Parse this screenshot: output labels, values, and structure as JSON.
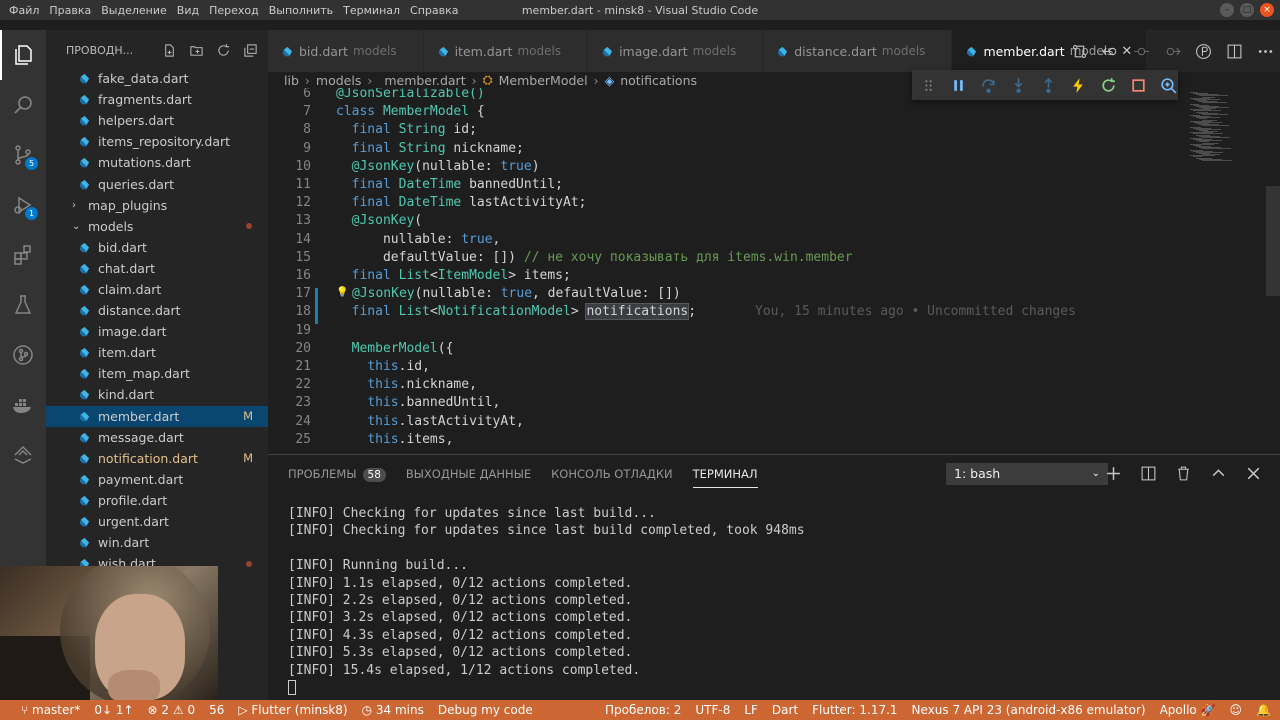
{
  "window": {
    "title": "member.dart - minsk8 - Visual Studio Code",
    "menu": [
      "Файл",
      "Правка",
      "Выделение",
      "Вид",
      "Переход",
      "Выполнить",
      "Терминал",
      "Справка"
    ]
  },
  "activity": {
    "scm_badge": "5",
    "debug_badge": "1",
    "icons": [
      "explorer-icon",
      "search-icon",
      "source-control-icon",
      "run-debug-icon",
      "extensions-icon",
      "testing-icon",
      "git-graph-icon",
      "docker-icon",
      "deploy-icon"
    ]
  },
  "sidebar": {
    "title": "ПРОВОДН...",
    "items": [
      {
        "label": "fake_data.dart",
        "indent": 2,
        "type": "file",
        "mark": ""
      },
      {
        "label": "fragments.dart",
        "indent": 2,
        "type": "file",
        "mark": ""
      },
      {
        "label": "helpers.dart",
        "indent": 2,
        "type": "file",
        "mark": ""
      },
      {
        "label": "items_repository.dart",
        "indent": 2,
        "type": "file",
        "mark": ""
      },
      {
        "label": "mutations.dart",
        "indent": 2,
        "type": "file",
        "mark": ""
      },
      {
        "label": "queries.dart",
        "indent": 2,
        "type": "file",
        "mark": ""
      },
      {
        "label": "map_plugins",
        "indent": 1,
        "type": "folder-closed",
        "mark": ""
      },
      {
        "label": "models",
        "indent": 1,
        "type": "folder-open",
        "mark": "dot"
      },
      {
        "label": "bid.dart",
        "indent": 2,
        "type": "file",
        "mark": ""
      },
      {
        "label": "chat.dart",
        "indent": 2,
        "type": "file",
        "mark": ""
      },
      {
        "label": "claim.dart",
        "indent": 2,
        "type": "file",
        "mark": ""
      },
      {
        "label": "distance.dart",
        "indent": 2,
        "type": "file",
        "mark": ""
      },
      {
        "label": "image.dart",
        "indent": 2,
        "type": "file",
        "mark": ""
      },
      {
        "label": "item.dart",
        "indent": 2,
        "type": "file",
        "mark": ""
      },
      {
        "label": "item_map.dart",
        "indent": 2,
        "type": "file",
        "mark": ""
      },
      {
        "label": "kind.dart",
        "indent": 2,
        "type": "file",
        "mark": ""
      },
      {
        "label": "member.dart",
        "indent": 2,
        "type": "file",
        "mark": "M",
        "selected": true
      },
      {
        "label": "message.dart",
        "indent": 2,
        "type": "file",
        "mark": ""
      },
      {
        "label": "notification.dart",
        "indent": 2,
        "type": "file",
        "mark": "M",
        "modified": true
      },
      {
        "label": "payment.dart",
        "indent": 2,
        "type": "file",
        "mark": ""
      },
      {
        "label": "profile.dart",
        "indent": 2,
        "type": "file",
        "mark": ""
      },
      {
        "label": "urgent.dart",
        "indent": 2,
        "type": "file",
        "mark": ""
      },
      {
        "label": "win.dart",
        "indent": 2,
        "type": "file",
        "mark": ""
      },
      {
        "label": "wish.dart",
        "indent": 2,
        "type": "file",
        "mark": "dot"
      }
    ]
  },
  "tabs": [
    {
      "name": "bid.dart",
      "desc": "models",
      "active": false
    },
    {
      "name": "item.dart",
      "desc": "models",
      "active": false
    },
    {
      "name": "image.dart",
      "desc": "models",
      "active": false
    },
    {
      "name": "distance.dart",
      "desc": "models",
      "active": false
    },
    {
      "name": "member.dart",
      "desc": "models",
      "active": true
    }
  ],
  "breadcrumbs": [
    "lib",
    "models",
    "member.dart",
    "MemberModel",
    "notifications"
  ],
  "editor": {
    "lines": [
      {
        "n": "6",
        "tokens": [
          [
            "an",
            "@JsonSerializable()"
          ]
        ]
      },
      {
        "n": "7",
        "tokens": [
          [
            "kw",
            "class "
          ],
          [
            "ty",
            "MemberModel"
          ],
          [
            "",
            " {"
          ]
        ]
      },
      {
        "n": "8",
        "tokens": [
          [
            "",
            "  "
          ],
          [
            "kw",
            "final "
          ],
          [
            "ty",
            "String"
          ],
          [
            "",
            " id;"
          ]
        ]
      },
      {
        "n": "9",
        "tokens": [
          [
            "",
            "  "
          ],
          [
            "kw",
            "final "
          ],
          [
            "ty",
            "String"
          ],
          [
            "",
            " nickname;"
          ]
        ]
      },
      {
        "n": "10",
        "tokens": [
          [
            "",
            "  "
          ],
          [
            "an",
            "@JsonKey"
          ],
          [
            "",
            "(nullable: "
          ],
          [
            "kw",
            "true"
          ],
          [
            "",
            ")"
          ]
        ]
      },
      {
        "n": "11",
        "tokens": [
          [
            "",
            "  "
          ],
          [
            "kw",
            "final "
          ],
          [
            "ty",
            "DateTime"
          ],
          [
            "",
            " bannedUntil;"
          ]
        ]
      },
      {
        "n": "12",
        "tokens": [
          [
            "",
            "  "
          ],
          [
            "kw",
            "final "
          ],
          [
            "ty",
            "DateTime"
          ],
          [
            "",
            " lastActivityAt;"
          ]
        ]
      },
      {
        "n": "13",
        "tokens": [
          [
            "",
            "  "
          ],
          [
            "an",
            "@JsonKey"
          ],
          [
            "",
            "("
          ]
        ]
      },
      {
        "n": "14",
        "tokens": [
          [
            "",
            "      nullable: "
          ],
          [
            "kw",
            "true"
          ],
          [
            "",
            ","
          ]
        ]
      },
      {
        "n": "15",
        "tokens": [
          [
            "",
            "      defaultValue: []) "
          ],
          [
            "cm",
            "// не хочу показывать для items.win.member"
          ]
        ]
      },
      {
        "n": "16",
        "tokens": [
          [
            "",
            "  "
          ],
          [
            "kw",
            "final "
          ],
          [
            "ty",
            "List"
          ],
          [
            "",
            "<"
          ],
          [
            "ty",
            "ItemModel"
          ],
          [
            "",
            "> items;"
          ]
        ]
      },
      {
        "n": "17",
        "tokens": [
          [
            "",
            "  "
          ],
          [
            "an",
            "@JsonKey"
          ],
          [
            "",
            "(nullable: "
          ],
          [
            "kw",
            "true"
          ],
          [
            "",
            ", defaultValue: [])"
          ]
        ]
      },
      {
        "n": "18",
        "tokens": [
          [
            "",
            "  "
          ],
          [
            "kw",
            "final "
          ],
          [
            "ty",
            "List"
          ],
          [
            "",
            "<"
          ],
          [
            "ty",
            "NotificationModel"
          ],
          [
            "",
            "> "
          ],
          [
            "hl",
            "notifications"
          ],
          [
            "",
            ";"
          ]
        ]
      },
      {
        "n": "19",
        "tokens": []
      },
      {
        "n": "20",
        "tokens": [
          [
            "",
            "  "
          ],
          [
            "ty",
            "MemberModel"
          ],
          [
            "",
            "({"
          ]
        ]
      },
      {
        "n": "21",
        "tokens": [
          [
            "",
            "    "
          ],
          [
            "kw",
            "this"
          ],
          [
            "",
            ".id,"
          ]
        ]
      },
      {
        "n": "22",
        "tokens": [
          [
            "",
            "    "
          ],
          [
            "kw",
            "this"
          ],
          [
            "",
            ".nickname,"
          ]
        ]
      },
      {
        "n": "23",
        "tokens": [
          [
            "",
            "    "
          ],
          [
            "kw",
            "this"
          ],
          [
            "",
            ".bannedUntil,"
          ]
        ]
      },
      {
        "n": "24",
        "tokens": [
          [
            "",
            "    "
          ],
          [
            "kw",
            "this"
          ],
          [
            "",
            ".lastActivityAt,"
          ]
        ]
      },
      {
        "n": "25",
        "tokens": [
          [
            "",
            "    "
          ],
          [
            "kw",
            "this"
          ],
          [
            "",
            ".items,"
          ]
        ]
      }
    ],
    "blame": "You, 15 minutes ago • Uncommitted changes"
  },
  "panel": {
    "tabs": [
      {
        "label": "ПРОБЛЕМЫ",
        "count": "58",
        "active": false
      },
      {
        "label": "ВЫХОДНЫЕ ДАННЫЕ",
        "count": "",
        "active": false
      },
      {
        "label": "КОНСОЛЬ ОТЛАДКИ",
        "count": "",
        "active": false
      },
      {
        "label": "ТЕРМИНАЛ",
        "count": "",
        "active": true
      }
    ],
    "terminal_select": "1: bash",
    "terminal_lines": [
      "[INFO] Checking for updates since last build...",
      "[INFO] Checking for updates since last build completed, took 948ms",
      "",
      "[INFO] Running build...",
      "[INFO] 1.1s elapsed, 0/12 actions completed.",
      "[INFO] 2.2s elapsed, 0/12 actions completed.",
      "[INFO] 3.2s elapsed, 0/12 actions completed.",
      "[INFO] 4.3s elapsed, 0/12 actions completed.",
      "[INFO] 5.3s elapsed, 0/12 actions completed.",
      "[INFO] 15.4s elapsed, 1/12 actions completed."
    ]
  },
  "status": {
    "branch": "master*",
    "sync": "0↓ 1↑",
    "problems": "⊗ 2 ⚠ 0",
    "count": "56",
    "flutter_run": "▷ Flutter (minsk8)",
    "time": "◷ 34 mins",
    "debug": "Debug my code",
    "spaces": "Пробелов: 2",
    "encoding": "UTF-8",
    "eol": "LF",
    "language": "Dart",
    "flutter_version": "Flutter: 1.17.1",
    "device": "Nexus 7 API 23 (android-x86 emulator)",
    "apollo": "Apollo"
  },
  "colors": {
    "status_bar": "#cc6633",
    "selection": "#094771",
    "accent": "#007acc"
  }
}
